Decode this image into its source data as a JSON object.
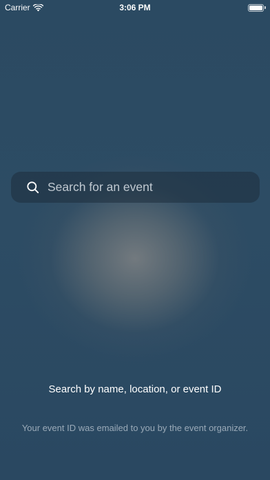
{
  "status_bar": {
    "carrier": "Carrier",
    "time": "3:06 PM",
    "icons": [
      "wifi-icon",
      "battery-icon"
    ]
  },
  "search": {
    "icon": "search-icon",
    "placeholder": "Search for an event"
  },
  "hint": {
    "title": "Search by name, location, or event ID",
    "body": "Your event ID was emailed to you by the event organizer."
  },
  "colors": {
    "background": "#2c4b63",
    "search_field_bg": "#1e2e3c",
    "text_primary": "#ffffff",
    "text_secondary": "#dce4ec"
  }
}
